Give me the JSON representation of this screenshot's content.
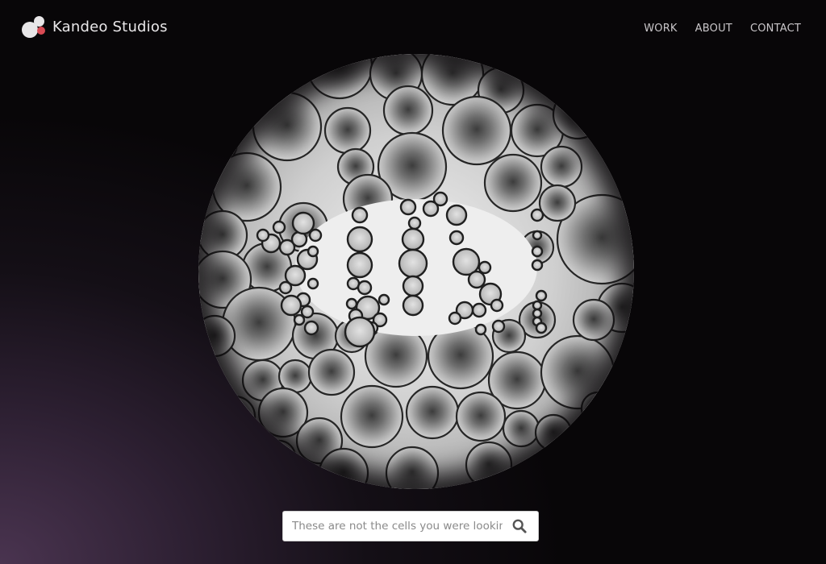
{
  "header": {
    "brand_name": "Kandeo Studios",
    "nav": [
      {
        "label": "WORK"
      },
      {
        "label": "ABOUT"
      },
      {
        "label": "CONTACT"
      }
    ]
  },
  "hero": {
    "image_icon": "microscope-cells-404"
  },
  "search": {
    "placeholder": "These are not the cells you were looking for.",
    "value": "",
    "icon": "search-icon"
  },
  "colors": {
    "accent": "#d94b54",
    "background_dark": "#080608",
    "background_glow": "#4a3450"
  }
}
